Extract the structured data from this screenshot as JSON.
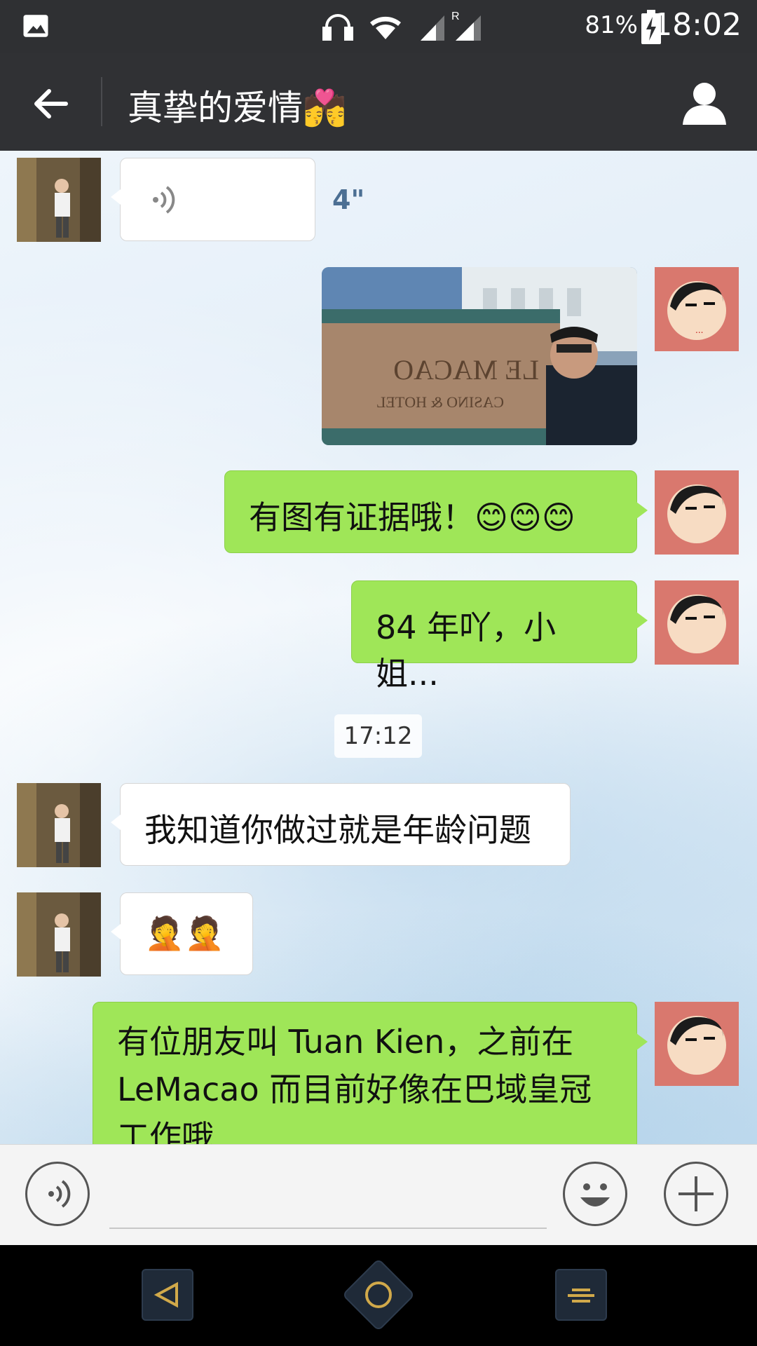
{
  "status_bar": {
    "battery_percent": "81%",
    "time": "18:02"
  },
  "header": {
    "title": "真挚的爱情💏"
  },
  "messages": {
    "voice_duration": "4\"",
    "green1": "有图有证据哦！😊😊😊",
    "green2": "84 年吖，小姐...",
    "timestamp": "17:12",
    "white1": "我知道你做过就是年龄问题",
    "white2": "🤦🤦",
    "green3": "有位朋友叫 Tuan Kien，之前在 LeMacao 而目前好像在巴域皇冠工作哦"
  },
  "photo": {
    "sign_text": "LE MACAO",
    "sign_sub": "CASINO & HOTEL"
  },
  "colors": {
    "header_bg": "#303134",
    "green_bubble": "#9fe658",
    "white_bubble": "#ffffff"
  },
  "icons": {
    "back": "arrow-left-icon",
    "profile": "person-icon",
    "voice": "voice-icon",
    "emoji": "smiley-icon",
    "plus": "plus-icon"
  }
}
